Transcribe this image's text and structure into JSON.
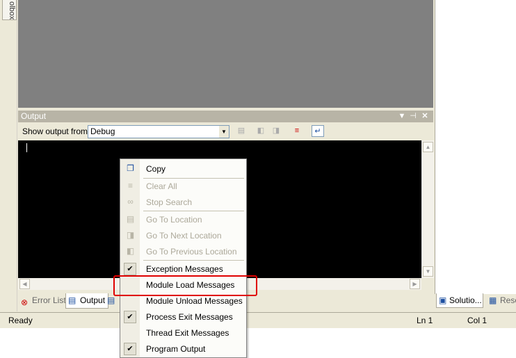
{
  "toolbox": {
    "label": "olbox"
  },
  "output": {
    "title": "Output",
    "show_from_label": "Show output from:",
    "source_value": "Debug"
  },
  "bottom_tabs": [
    {
      "label": "Error List"
    },
    {
      "label": "Output"
    }
  ],
  "right_tabs": [
    {
      "label": "Solutio..."
    },
    {
      "label": "Reso"
    }
  ],
  "status": {
    "text": "Ready",
    "line": "Ln 1",
    "col": "Col 1"
  },
  "menu": {
    "items": [
      {
        "label": "Copy",
        "icon": "copy-icon",
        "enabled": true,
        "checked": false
      },
      {
        "label": "Clear All",
        "icon": "clear-all-icon",
        "enabled": false,
        "checked": false
      },
      {
        "label": "Stop Search",
        "icon": "binoculars-icon",
        "enabled": false,
        "checked": false
      },
      {
        "label": "Go To Location",
        "icon": "go-to-location-icon",
        "enabled": false,
        "checked": false
      },
      {
        "label": "Go To Next Location",
        "icon": "next-location-icon",
        "enabled": false,
        "checked": false
      },
      {
        "label": "Go To Previous Location",
        "icon": "previous-location-icon",
        "enabled": false,
        "checked": false
      },
      {
        "label": "Exception Messages",
        "enabled": true,
        "checked": true
      },
      {
        "label": "Module Load Messages",
        "enabled": true,
        "checked": false
      },
      {
        "label": "Module Unload Messages",
        "enabled": true,
        "checked": false
      },
      {
        "label": "Process Exit Messages",
        "enabled": true,
        "checked": true
      },
      {
        "label": "Thread Exit Messages",
        "enabled": true,
        "checked": false
      },
      {
        "label": "Program Output",
        "enabled": true,
        "checked": true
      }
    ]
  },
  "colors": {
    "highlight": "#e00000",
    "output_background": "#000000"
  }
}
